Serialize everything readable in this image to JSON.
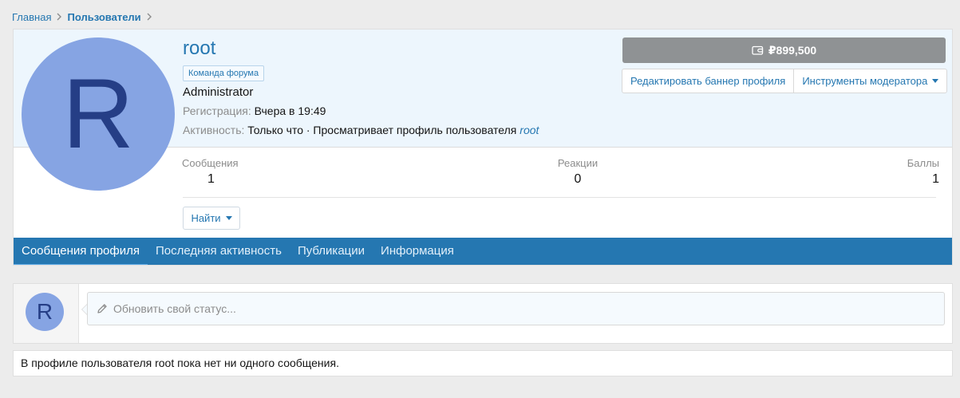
{
  "breadcrumb": {
    "items": [
      {
        "label": "Главная"
      },
      {
        "label": "Пользователи"
      }
    ]
  },
  "profile": {
    "avatar_letter": "R",
    "username": "root",
    "banner": "Команда форума",
    "user_title": "Administrator",
    "registration_label": "Регистрация:",
    "registration_value": "Вчера в 19:49",
    "activity_label": "Активность:",
    "activity_value": "Только что · Просматривает профиль пользователя",
    "activity_link": "root",
    "balance": "₽899,500",
    "edit_banner_label": "Редактировать баннер профиля",
    "moderator_tools_label": "Инструменты модератора",
    "stats": {
      "messages_label": "Сообщения",
      "messages_value": "1",
      "reactions_label": "Реакции",
      "reactions_value": "0",
      "points_label": "Баллы",
      "points_value": "1"
    },
    "find_label": "Найти",
    "tabs": [
      {
        "label": "Сообщения профиля",
        "active": true
      },
      {
        "label": "Последняя активность"
      },
      {
        "label": "Публикации"
      },
      {
        "label": "Информация"
      }
    ]
  },
  "status": {
    "avatar_letter": "R",
    "placeholder": "Обновить свой статус..."
  },
  "empty_message": "В профиле пользователя root пока нет ни одного сообщения.",
  "colors": {
    "accent": "#2577b1",
    "avatar_bg": "#86a4e3",
    "avatar_fg": "#253e86",
    "balance_bg": "#8f9294"
  },
  "icons": [
    "chevron-right-icon",
    "wallet-icon",
    "caret-down-icon",
    "pencil-icon"
  ]
}
